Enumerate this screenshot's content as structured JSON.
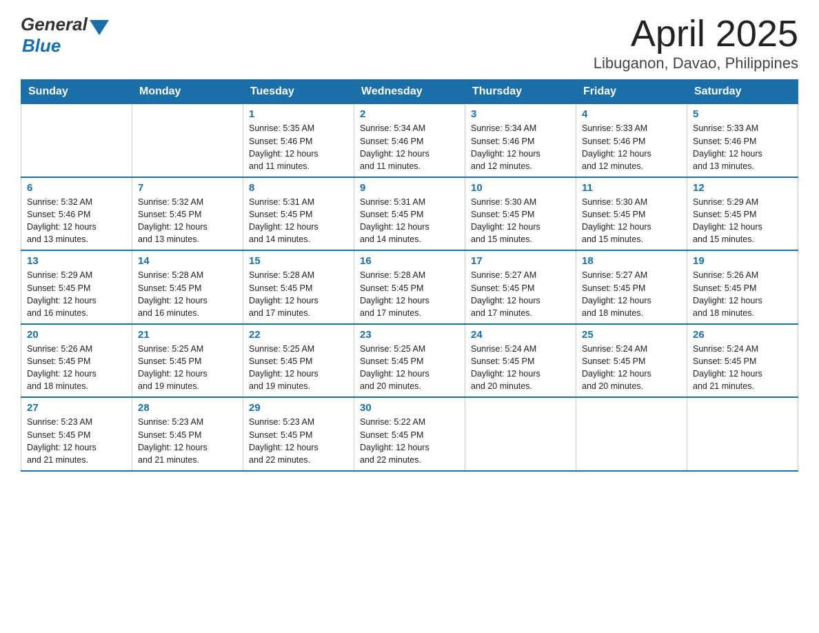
{
  "header": {
    "title": "April 2025",
    "subtitle": "Libuganon, Davao, Philippines",
    "logo_general": "General",
    "logo_blue": "Blue"
  },
  "weekdays": [
    "Sunday",
    "Monday",
    "Tuesday",
    "Wednesday",
    "Thursday",
    "Friday",
    "Saturday"
  ],
  "weeks": [
    [
      {
        "day": "",
        "info": ""
      },
      {
        "day": "",
        "info": ""
      },
      {
        "day": "1",
        "info": "Sunrise: 5:35 AM\nSunset: 5:46 PM\nDaylight: 12 hours\nand 11 minutes."
      },
      {
        "day": "2",
        "info": "Sunrise: 5:34 AM\nSunset: 5:46 PM\nDaylight: 12 hours\nand 11 minutes."
      },
      {
        "day": "3",
        "info": "Sunrise: 5:34 AM\nSunset: 5:46 PM\nDaylight: 12 hours\nand 12 minutes."
      },
      {
        "day": "4",
        "info": "Sunrise: 5:33 AM\nSunset: 5:46 PM\nDaylight: 12 hours\nand 12 minutes."
      },
      {
        "day": "5",
        "info": "Sunrise: 5:33 AM\nSunset: 5:46 PM\nDaylight: 12 hours\nand 13 minutes."
      }
    ],
    [
      {
        "day": "6",
        "info": "Sunrise: 5:32 AM\nSunset: 5:46 PM\nDaylight: 12 hours\nand 13 minutes."
      },
      {
        "day": "7",
        "info": "Sunrise: 5:32 AM\nSunset: 5:45 PM\nDaylight: 12 hours\nand 13 minutes."
      },
      {
        "day": "8",
        "info": "Sunrise: 5:31 AM\nSunset: 5:45 PM\nDaylight: 12 hours\nand 14 minutes."
      },
      {
        "day": "9",
        "info": "Sunrise: 5:31 AM\nSunset: 5:45 PM\nDaylight: 12 hours\nand 14 minutes."
      },
      {
        "day": "10",
        "info": "Sunrise: 5:30 AM\nSunset: 5:45 PM\nDaylight: 12 hours\nand 15 minutes."
      },
      {
        "day": "11",
        "info": "Sunrise: 5:30 AM\nSunset: 5:45 PM\nDaylight: 12 hours\nand 15 minutes."
      },
      {
        "day": "12",
        "info": "Sunrise: 5:29 AM\nSunset: 5:45 PM\nDaylight: 12 hours\nand 15 minutes."
      }
    ],
    [
      {
        "day": "13",
        "info": "Sunrise: 5:29 AM\nSunset: 5:45 PM\nDaylight: 12 hours\nand 16 minutes."
      },
      {
        "day": "14",
        "info": "Sunrise: 5:28 AM\nSunset: 5:45 PM\nDaylight: 12 hours\nand 16 minutes."
      },
      {
        "day": "15",
        "info": "Sunrise: 5:28 AM\nSunset: 5:45 PM\nDaylight: 12 hours\nand 17 minutes."
      },
      {
        "day": "16",
        "info": "Sunrise: 5:28 AM\nSunset: 5:45 PM\nDaylight: 12 hours\nand 17 minutes."
      },
      {
        "day": "17",
        "info": "Sunrise: 5:27 AM\nSunset: 5:45 PM\nDaylight: 12 hours\nand 17 minutes."
      },
      {
        "day": "18",
        "info": "Sunrise: 5:27 AM\nSunset: 5:45 PM\nDaylight: 12 hours\nand 18 minutes."
      },
      {
        "day": "19",
        "info": "Sunrise: 5:26 AM\nSunset: 5:45 PM\nDaylight: 12 hours\nand 18 minutes."
      }
    ],
    [
      {
        "day": "20",
        "info": "Sunrise: 5:26 AM\nSunset: 5:45 PM\nDaylight: 12 hours\nand 18 minutes."
      },
      {
        "day": "21",
        "info": "Sunrise: 5:25 AM\nSunset: 5:45 PM\nDaylight: 12 hours\nand 19 minutes."
      },
      {
        "day": "22",
        "info": "Sunrise: 5:25 AM\nSunset: 5:45 PM\nDaylight: 12 hours\nand 19 minutes."
      },
      {
        "day": "23",
        "info": "Sunrise: 5:25 AM\nSunset: 5:45 PM\nDaylight: 12 hours\nand 20 minutes."
      },
      {
        "day": "24",
        "info": "Sunrise: 5:24 AM\nSunset: 5:45 PM\nDaylight: 12 hours\nand 20 minutes."
      },
      {
        "day": "25",
        "info": "Sunrise: 5:24 AM\nSunset: 5:45 PM\nDaylight: 12 hours\nand 20 minutes."
      },
      {
        "day": "26",
        "info": "Sunrise: 5:24 AM\nSunset: 5:45 PM\nDaylight: 12 hours\nand 21 minutes."
      }
    ],
    [
      {
        "day": "27",
        "info": "Sunrise: 5:23 AM\nSunset: 5:45 PM\nDaylight: 12 hours\nand 21 minutes."
      },
      {
        "day": "28",
        "info": "Sunrise: 5:23 AM\nSunset: 5:45 PM\nDaylight: 12 hours\nand 21 minutes."
      },
      {
        "day": "29",
        "info": "Sunrise: 5:23 AM\nSunset: 5:45 PM\nDaylight: 12 hours\nand 22 minutes."
      },
      {
        "day": "30",
        "info": "Sunrise: 5:22 AM\nSunset: 5:45 PM\nDaylight: 12 hours\nand 22 minutes."
      },
      {
        "day": "",
        "info": ""
      },
      {
        "day": "",
        "info": ""
      },
      {
        "day": "",
        "info": ""
      }
    ]
  ]
}
